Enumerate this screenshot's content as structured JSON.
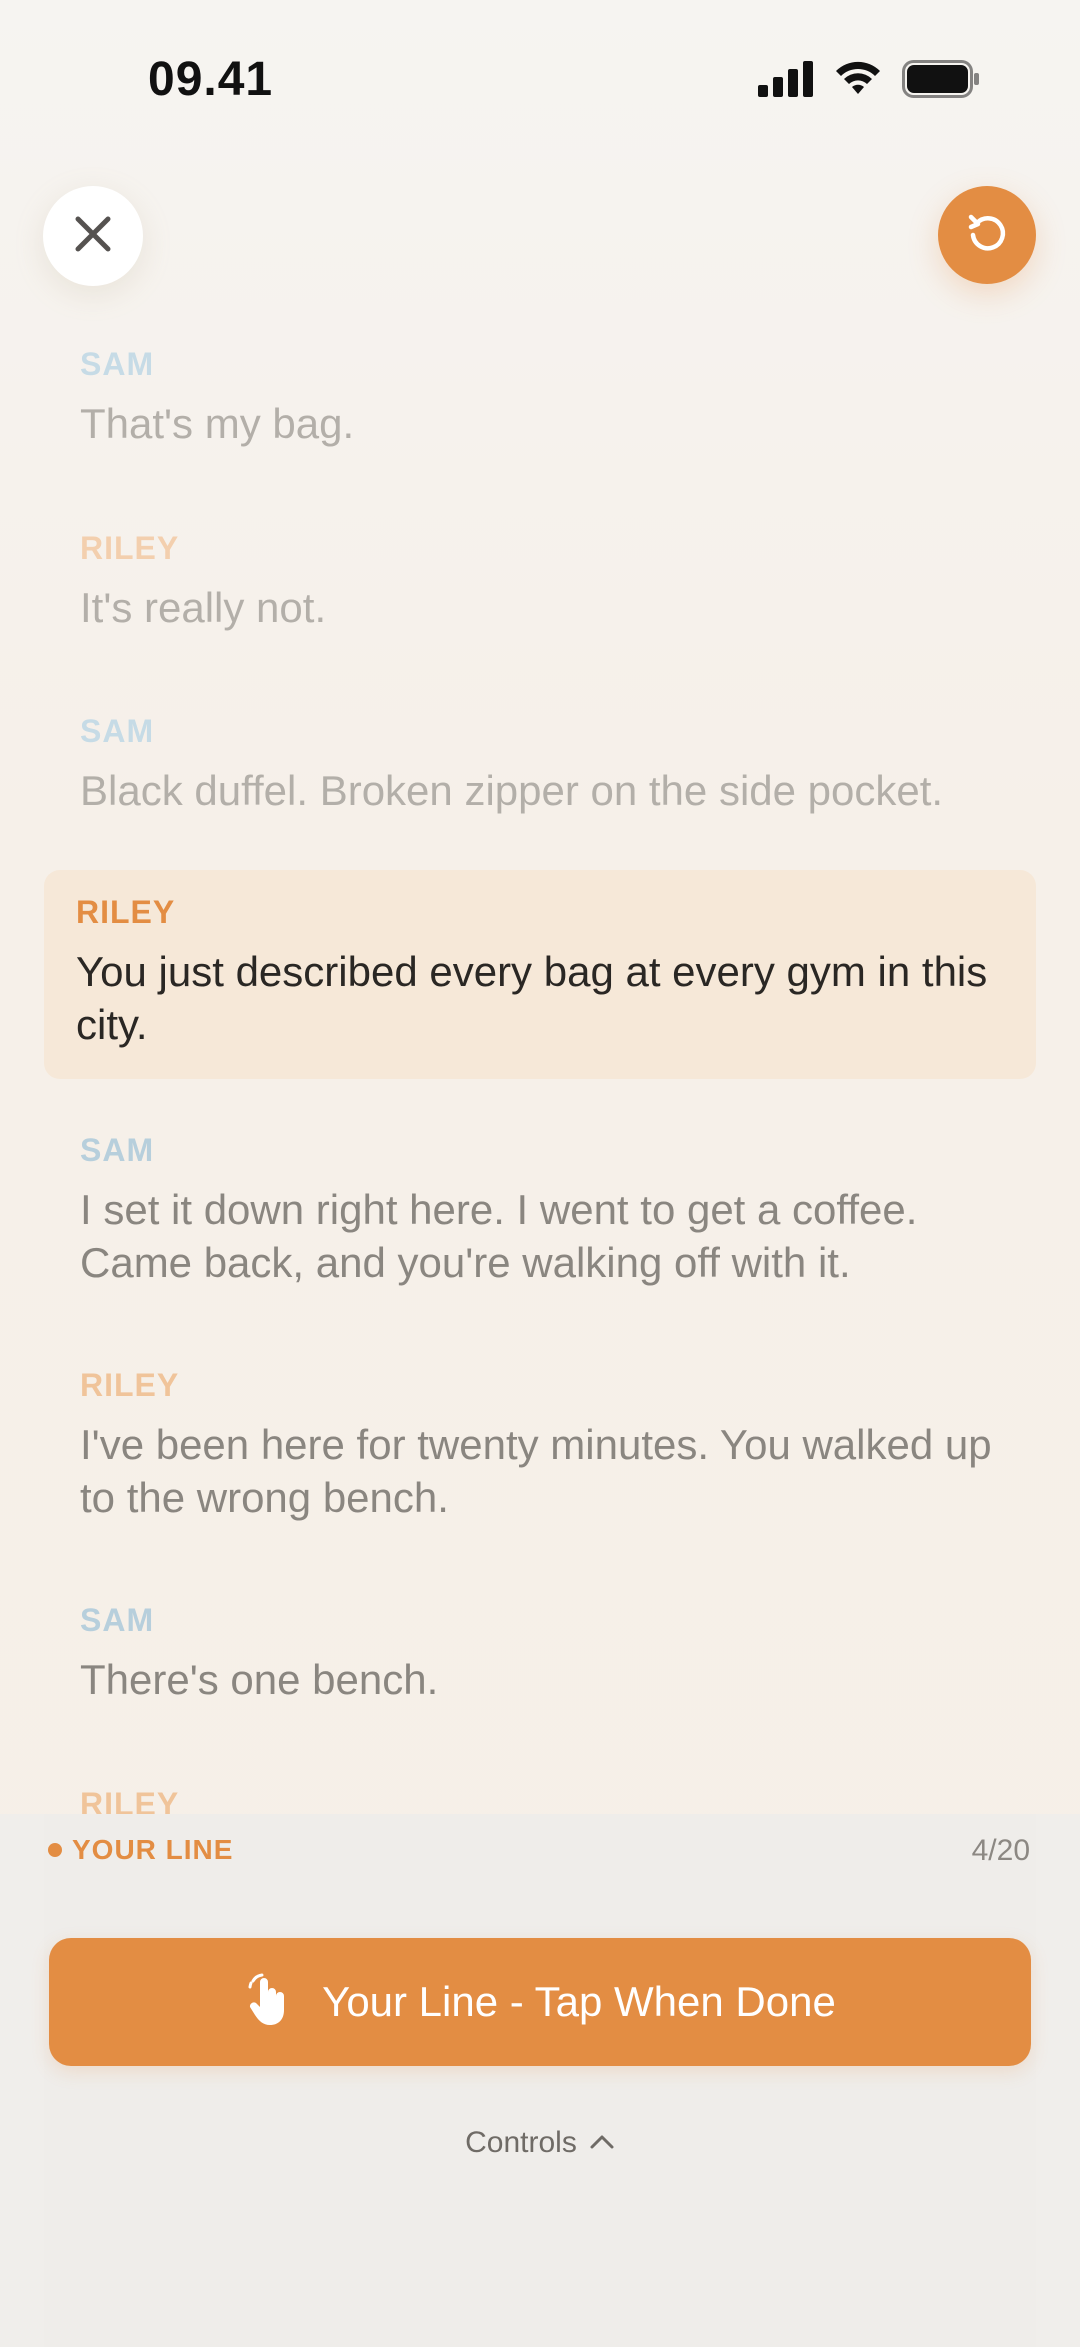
{
  "status_bar": {
    "time": "09.41"
  },
  "icons": {
    "close": "close-icon",
    "restart": "restart-icon",
    "tap": "tap-hand-icon",
    "chevron": "chevron-up-icon"
  },
  "colors": {
    "accent": "#e38d43",
    "sam": "#b7cfdc",
    "riley": "#f0c49a",
    "active_bg": "#f6e8d8"
  },
  "script": {
    "lines": [
      {
        "speaker": "SAM",
        "text": "That's my bag."
      },
      {
        "speaker": "RILEY",
        "text": "It's really not."
      },
      {
        "speaker": "SAM",
        "text": "Black duffel. Broken zipper on the side pocket."
      },
      {
        "speaker": "RILEY",
        "text": "You just described every bag at every gym in this city."
      },
      {
        "speaker": "SAM",
        "text": "I set it down right here. I went to get a coffee. Came back, and you're walking off with it."
      },
      {
        "speaker": "RILEY",
        "text": "I've been here for twenty minutes. You walked up to the wrong bench."
      },
      {
        "speaker": "SAM",
        "text": "There's one bench."
      },
      {
        "speaker": "RILEY",
        "text": ""
      }
    ]
  },
  "panel": {
    "your_line_label": "YOUR LINE",
    "counter": "4/20",
    "done_button_label": "Your Line - Tap When Done",
    "controls_label": "Controls"
  }
}
